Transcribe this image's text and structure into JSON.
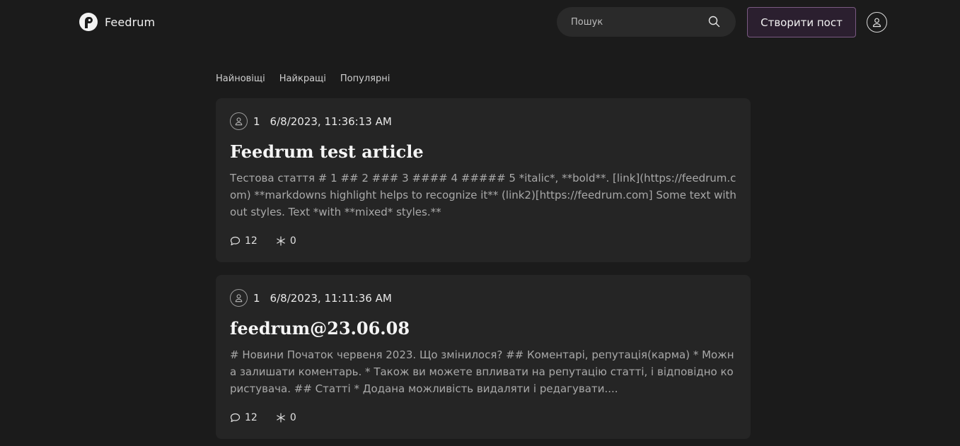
{
  "header": {
    "brand": "Feedrum",
    "search": {
      "placeholder": "Пошук",
      "value": ""
    },
    "create_post_label": "Створити пост",
    "icons": {
      "logo": "feedrum-logo-icon",
      "search": "search-icon",
      "profile": "user-icon"
    }
  },
  "tabs": [
    {
      "label": "Найновіщі"
    },
    {
      "label": "Найкращі"
    },
    {
      "label": "Популярні"
    }
  ],
  "posts": [
    {
      "author": "1",
      "date": "6/8/2023, 11:36:13 AM",
      "title": "Feedrum test article",
      "excerpt": "Тестова стаття # 1 ## 2 ### 3 #### 4 ##### 5 *italic*, **bold**. [link](https://feedrum.com) **markdowns highlight helps to recognize it** (link2)[https://feedrum.com] Some text without styles. Text *with **mixed* styles.**",
      "comments": "12",
      "reactions": "0"
    },
    {
      "author": "1",
      "date": "6/8/2023, 11:11:36 AM",
      "title": "feedrum@23.06.08",
      "excerpt": "# Новини Початок червеня 2023. Що змінилося? ## Коментарі, репутація(карма) * Можна залишати коментарь. * Також ви можете впливати на репутацію статті, і відповідно користувача. ## Статті * Додана можливість видаляти і редагувати....",
      "comments": "12",
      "reactions": "0"
    }
  ],
  "colors": {
    "background": "#1b1b1b",
    "card": "#252525",
    "accent_border": "#7a5a82",
    "accent_bg": "#2b1f2f"
  }
}
